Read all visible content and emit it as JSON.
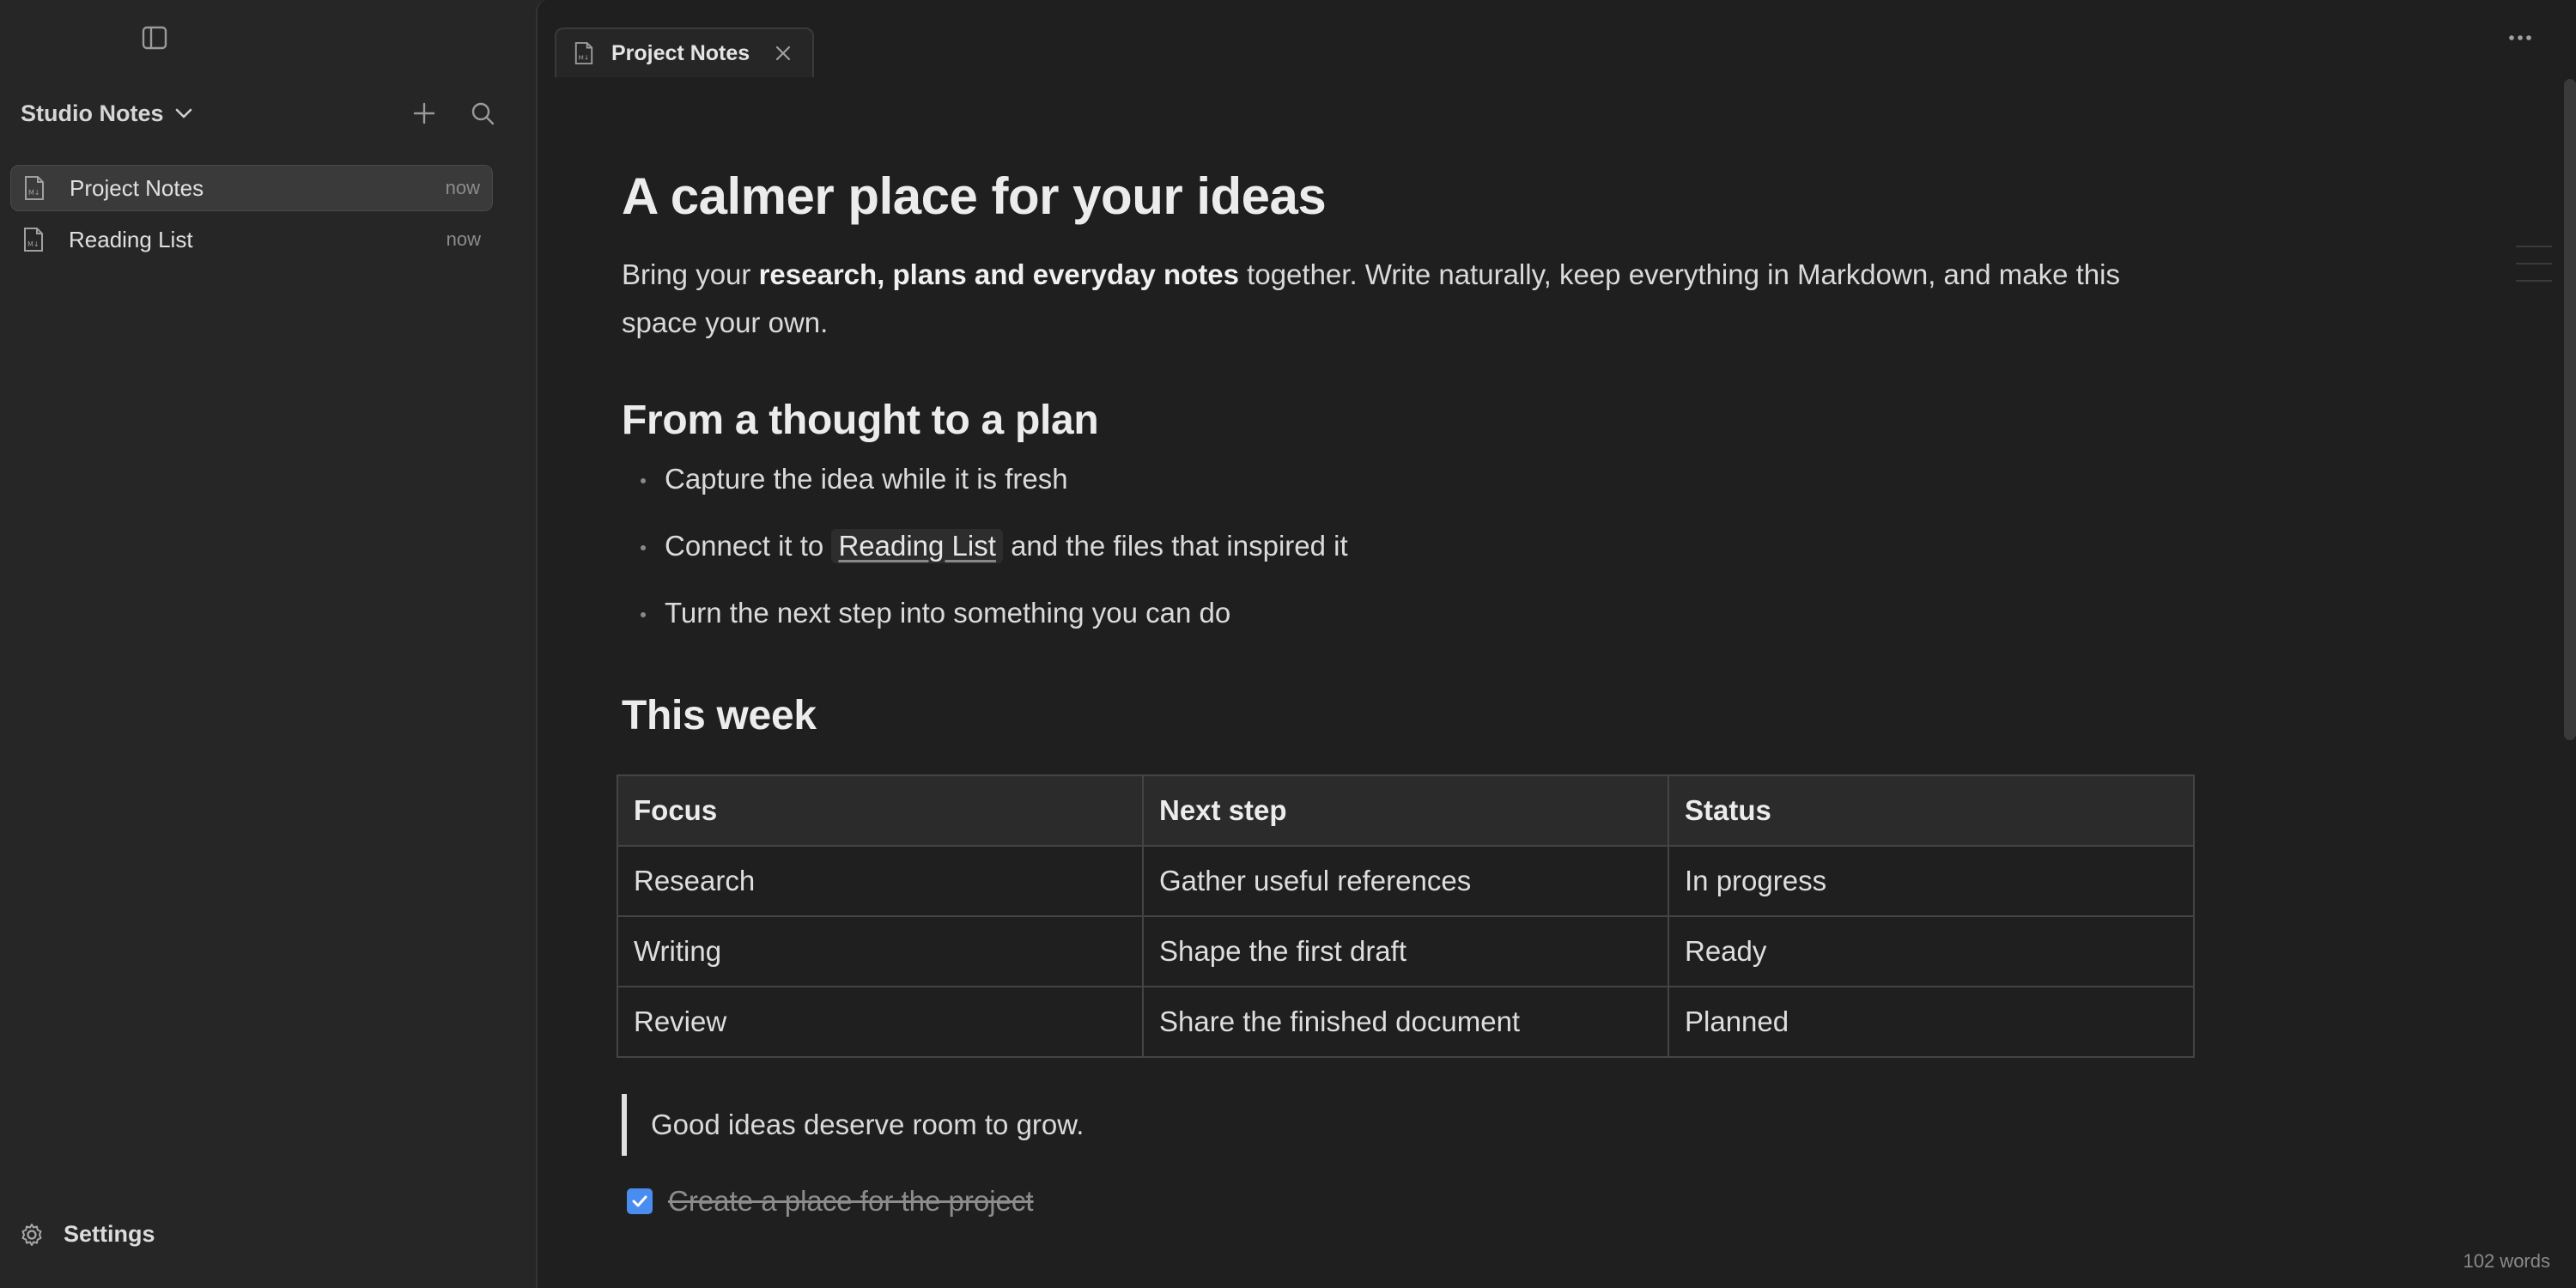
{
  "sidebar": {
    "vault_name": "Studio Notes",
    "files": [
      {
        "label": "Project Notes",
        "time": "now",
        "active": true
      },
      {
        "label": "Reading List",
        "time": "now",
        "active": false
      }
    ],
    "settings_label": "Settings"
  },
  "tab": {
    "label": "Project Notes"
  },
  "document": {
    "title": "A calmer place for your ideas",
    "intro_prefix": "Bring your ",
    "intro_bold": "research, plans and everyday notes",
    "intro_suffix": " together. Write naturally, keep everything in Markdown, and make this space your own.",
    "section_plan": "From a thought to a plan",
    "bullets": {
      "b1": "Capture the idea while it is fresh",
      "b2_prefix": "Connect it to ",
      "b2_link": "Reading List",
      "b2_suffix": " and the files that inspired it",
      "b3": "Turn the next step into something you can do"
    },
    "section_week": "This week",
    "table": {
      "headers": [
        "Focus",
        "Next step",
        "Status"
      ],
      "rows": [
        [
          "Research",
          "Gather useful references",
          "In progress"
        ],
        [
          "Writing",
          "Shape the first draft",
          "Ready"
        ],
        [
          "Review",
          "Share the finished document",
          "Planned"
        ]
      ]
    },
    "quote": "Good ideas deserve room to grow.",
    "task": {
      "label": "Create a place for the project",
      "checked": true
    }
  },
  "status": {
    "word_count": "102 words"
  },
  "colors": {
    "accent": "#4a8df0",
    "background": "#1f1f1f",
    "sidebar": "#262626"
  },
  "icons": [
    "sidebar-toggle-icon",
    "chevron-down-icon",
    "new-note-icon",
    "search-icon",
    "markdown-file-icon",
    "close-icon",
    "more-options-icon",
    "gear-icon",
    "checkmark-icon"
  ]
}
